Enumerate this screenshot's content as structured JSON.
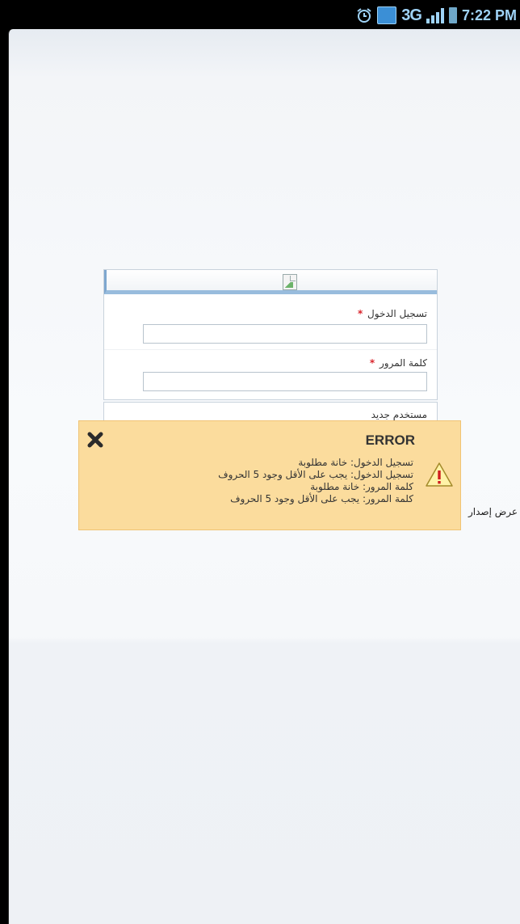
{
  "status_bar": {
    "network": "3G",
    "time": "7:22 PM",
    "icons": [
      "alarm-icon",
      "sim-icon",
      "signal-icon",
      "battery-icon"
    ]
  },
  "login": {
    "header_image": "broken-image-icon",
    "username_label": "تسجيل الدخول",
    "username_value": "",
    "password_label": "كلمة المرور",
    "password_value": "",
    "required_marker": "*",
    "new_user_label": "مستخدم جديد",
    "version_label": "عرض إصدار"
  },
  "error_dialog": {
    "title": "ERROR",
    "messages": [
      "تسجيل الدخول: خانة مطلوبة",
      "تسجيل الدخول: يجب على الأقل وجود 5 الحروف",
      "كلمة المرور: خانة مطلوبة",
      "كلمة المرور: يجب على الأقل وجود 5 الحروف"
    ],
    "close_icon": "close-icon",
    "warning_icon": "warning-icon"
  },
  "colors": {
    "accent": "#98bcdd",
    "error_bg": "#fbdc9d",
    "required": "#d9242b"
  }
}
